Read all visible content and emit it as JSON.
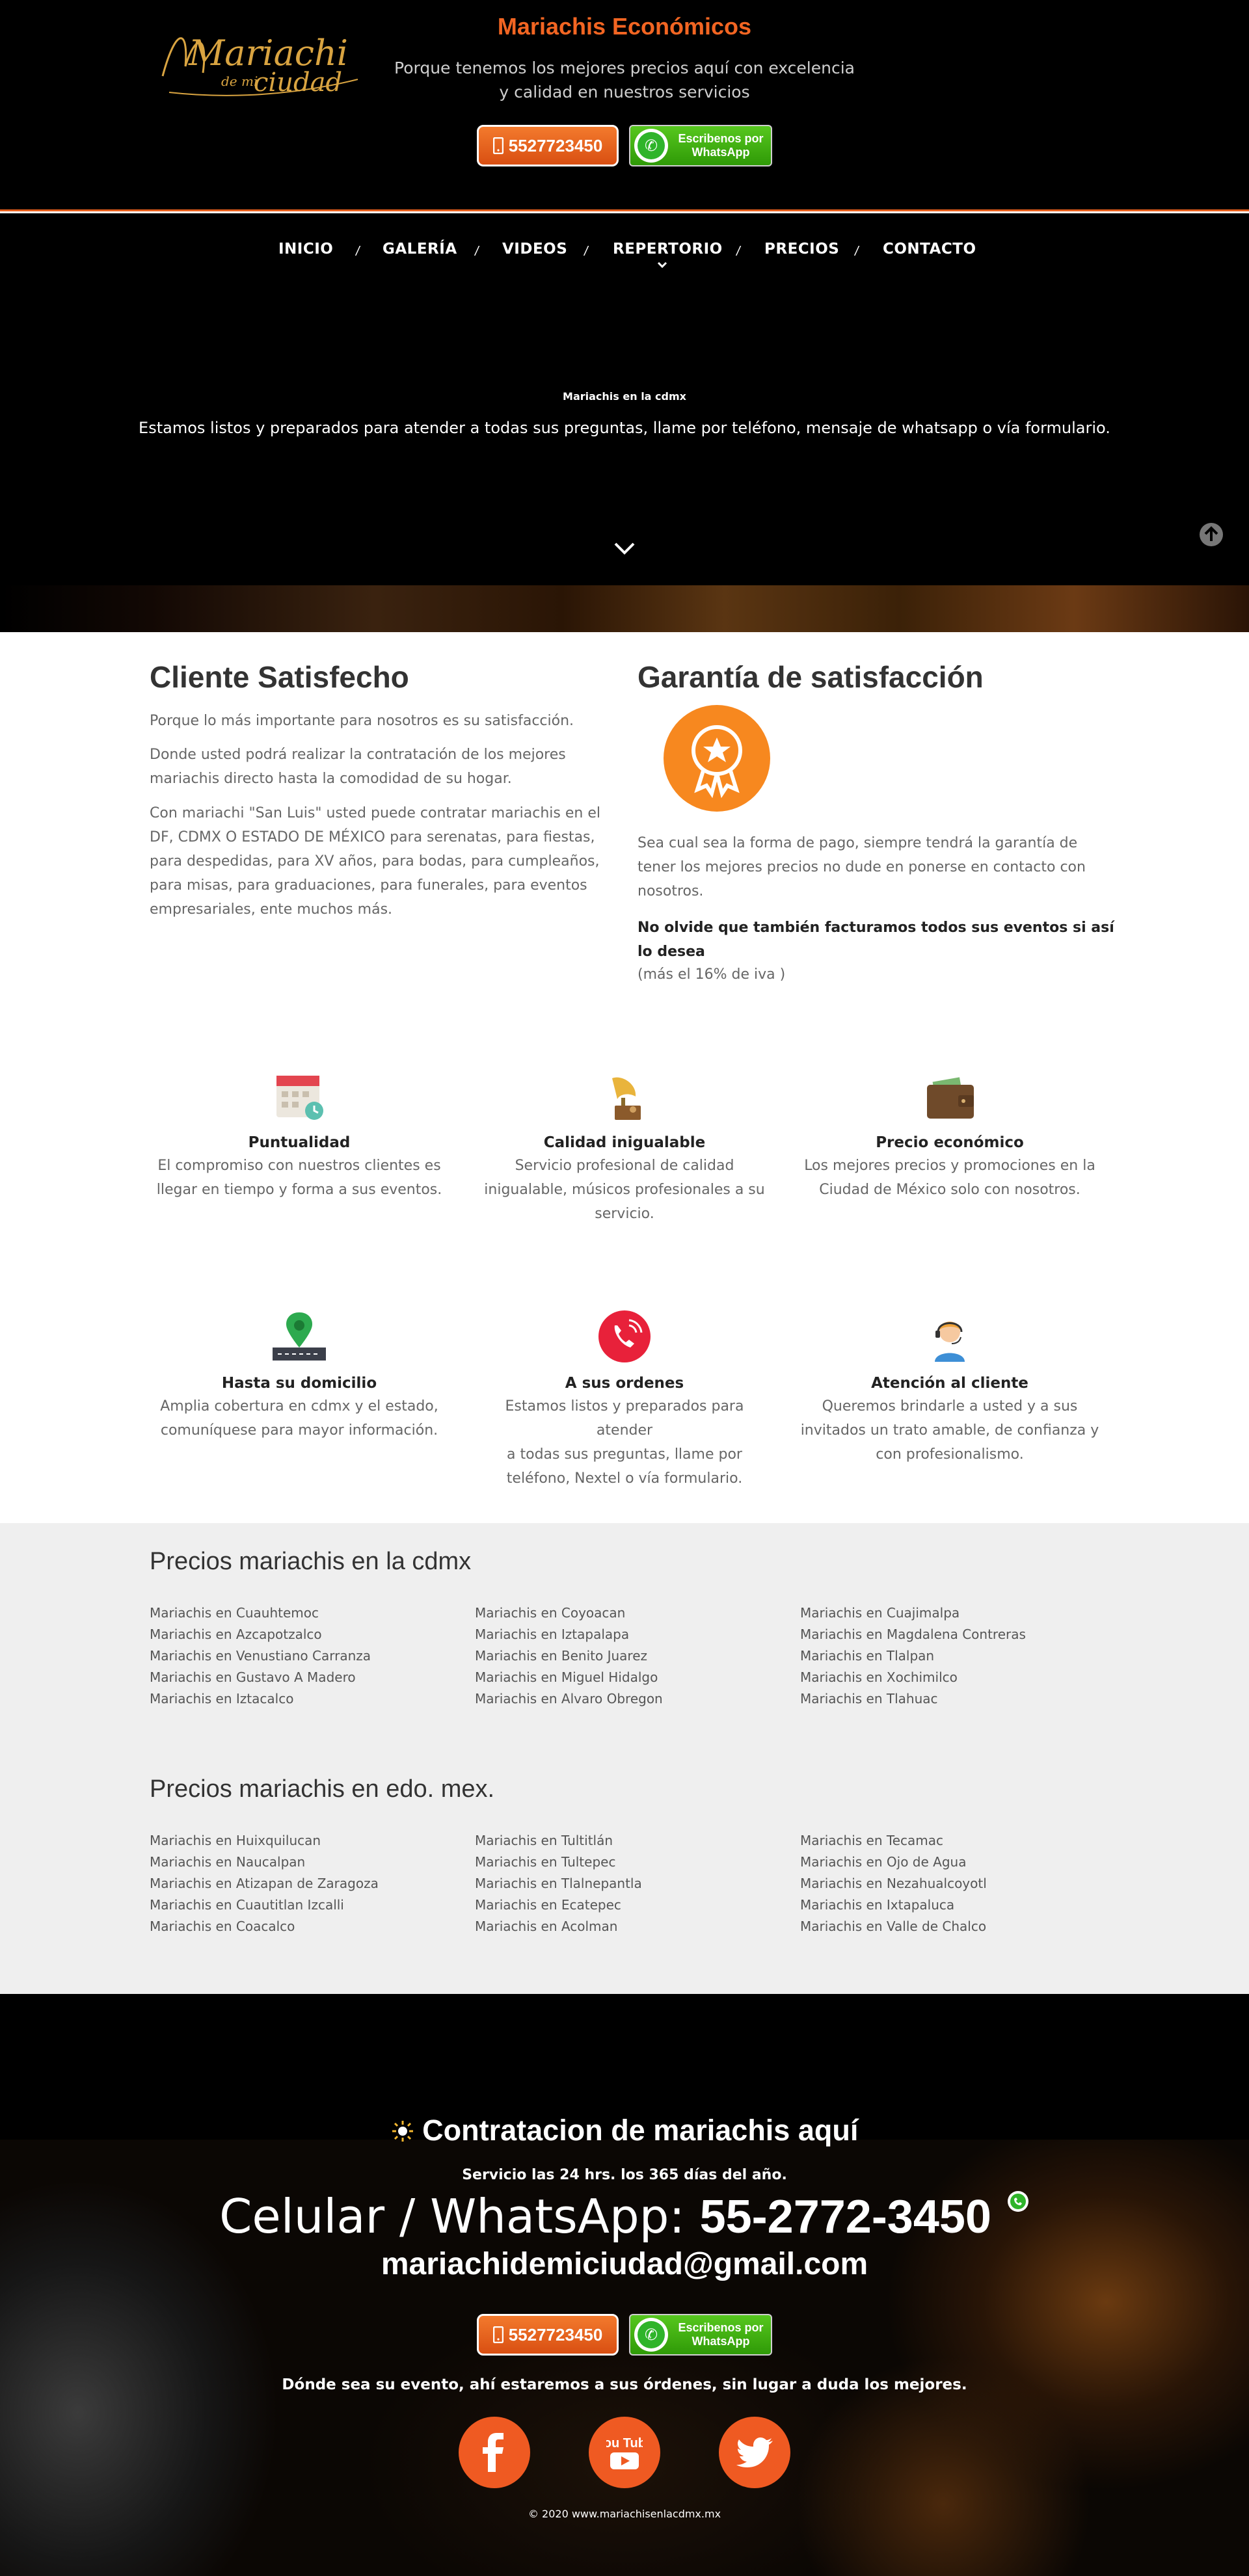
{
  "header": {
    "logo_text_main": "Mariachi",
    "logo_text_sub": "de mi",
    "logo_text_city": "ciudad",
    "title": "Mariachis Económicos",
    "subtitle_line1": "Porque tenemos los mejores precios aquí con excelencia",
    "subtitle_line2": "y calidad en nuestros servicios",
    "phone_button": "5527723450",
    "whatsapp_line1": "Escribenos por",
    "whatsapp_line2": "WhatsApp"
  },
  "nav": {
    "items": [
      "INICIO",
      "GALERÍA",
      "VIDEOS",
      "REPERTORIO",
      "PRECIOS",
      "CONTACTO"
    ],
    "separator": "/"
  },
  "hero": {
    "tag": "Mariachis en la cdmx",
    "text": "Estamos listos y preparados para atender a todas sus preguntas, llame por teléfono, mensaje de whatsapp o vía formulario."
  },
  "satisfaction": {
    "heading": "Cliente Satisfecho",
    "p1": "Porque lo más importante para nosotros es su satisfacción.",
    "p2_l1": "Donde usted podrá realizar la contratación de los mejores",
    "p2_l2": "mariachis directo hasta la comodidad de su hogar.",
    "p3_l1": "Con mariachi \"San Luis\" usted puede contratar mariachis en el",
    "p3_l2": "DF, CDMX O ESTADO DE MÉXICO para serenatas, para fiestas,",
    "p3_l3": "para despedidas, para XV años, para bodas, para cumpleaños,",
    "p3_l4": "para misas, para graduaciones, para funerales, para eventos",
    "p3_l5": "empresariales, ente muchos más."
  },
  "guarantee": {
    "heading": "Garantía de satisfacción",
    "p1_l1": "Sea cual sea la forma de pago, siempre tendrá la garantía de",
    "p1_l2": "tener los mejores precios no dude en ponerse en contacto con",
    "p1_l3": "nosotros.",
    "bold_l1": "No olvide que también facturamos todos sus eventos si así",
    "bold_l2": "lo desea",
    "note": "(más el 16% de iva )"
  },
  "features": [
    {
      "icon": "calendar-icon",
      "title": "Puntualidad",
      "d1": "El compromiso con nuestros clientes es",
      "d2": "llegar en tiempo y forma a sus eventos.",
      "d3": ""
    },
    {
      "icon": "gramophone-icon",
      "title": "Calidad inigualable",
      "d1": "Servicio profesional de calidad",
      "d2": "inigualable, músicos profesionales a su",
      "d3": "servicio."
    },
    {
      "icon": "wallet-icon",
      "title": "Precio económico",
      "d1": "Los mejores precios y promociones en la",
      "d2": "Ciudad de México solo con nosotros.",
      "d3": ""
    },
    {
      "icon": "map-pin-icon",
      "title": "Hasta su domicilio",
      "d1": "Amplia cobertura en cdmx y el estado,",
      "d2": "comuníquese para mayor información.",
      "d3": ""
    },
    {
      "icon": "phone-call-icon",
      "title": "A sus ordenes",
      "d1": "Estamos listos y preparados para atender",
      "d2": "a todas sus preguntas, llame por",
      "d3": "teléfono, Nextel o vía formulario."
    },
    {
      "icon": "support-agent-icon",
      "title": "Atención al cliente",
      "d1": "Queremos brindarle a usted y a sus",
      "d2": "invitados un trato amable, de confianza y",
      "d3": "con profesionalismo."
    }
  ],
  "prices_cdmx": {
    "heading": "Precios mariachis en la cdmx",
    "col1": [
      "Mariachis en Cuauhtemoc",
      "Mariachis en Azcapotzalco",
      "Mariachis en Venustiano Carranza",
      "Mariachis en Gustavo A Madero",
      "Mariachis en Iztacalco"
    ],
    "col2": [
      "Mariachis en Coyoacan",
      "Mariachis en Iztapalapa",
      "Mariachis en Benito Juarez",
      "Mariachis en Miguel Hidalgo",
      "Mariachis en Alvaro Obregon"
    ],
    "col3": [
      "Mariachis en Cuajimalpa",
      "Mariachis en Magdalena Contreras",
      "Mariachis en Tlalpan",
      "Mariachis en Xochimilco",
      "Mariachis en Tlahuac"
    ]
  },
  "prices_edomex": {
    "heading": "Precios mariachis en edo. mex.",
    "col1": [
      "Mariachis en Huixquilucan",
      "Mariachis en Naucalpan",
      "Mariachis en Atizapan de Zaragoza",
      "Mariachis en Cuautitlan Izcalli",
      "Mariachis en Coacalco"
    ],
    "col2": [
      "Mariachis en Tultitlán",
      "Mariachis en Tultepec",
      "Mariachis en Tlalnepantla",
      "Mariachis en Ecatepec",
      "Mariachis en Acolman"
    ],
    "col3": [
      "Mariachis en Tecamac",
      "Mariachis en Ojo de Agua",
      "Mariachis en Nezahualcoyotl",
      "Mariachis en Ixtapaluca",
      "Mariachis en Valle de Chalco"
    ]
  },
  "footer": {
    "heading": "Contratacion de mariachis aquí",
    "service": "Servicio las 24 hrs. los 365 días del año.",
    "phone_label": "Celular / WhatsApp: ",
    "phone_number": "55-2772-3450",
    "email": "mariachidemiciudad@gmail.com",
    "phone_button": "5527723450",
    "whatsapp_line1": "Escribenos por",
    "whatsapp_line2": "WhatsApp",
    "tagline": "Dónde sea su evento, ahí estaremos a sus órdenes, sin lugar a duda los mejores.",
    "social": [
      "facebook-icon",
      "youtube-icon",
      "twitter-icon"
    ],
    "youtube_label": "You Tube",
    "copyright": "© 2020 www.mariachisenlacdmx.mx"
  },
  "colors": {
    "accent": "#f26522",
    "nav_border": "#e8601c",
    "whatsapp_green": "#3aa70f",
    "badge_orange": "#f7881f",
    "prices_bg": "#efefef"
  }
}
